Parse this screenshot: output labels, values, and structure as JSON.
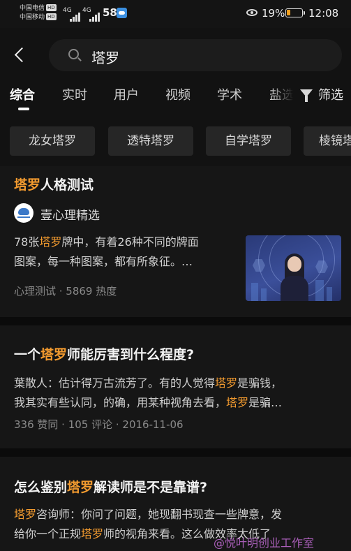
{
  "status_bar": {
    "carrier1": "中国电信",
    "carrier2": "中国移动",
    "hd_badge": "HD",
    "signal1_type": "4G",
    "signal2_type": "4G",
    "network": "58",
    "battery_percent": "19%",
    "battery_level": 0.19,
    "time": "12:08"
  },
  "search": {
    "query": "塔罗",
    "icon": "search-icon"
  },
  "tabs": [
    {
      "label": "综合",
      "active": true
    },
    {
      "label": "实时",
      "active": false
    },
    {
      "label": "用户",
      "active": false
    },
    {
      "label": "视频",
      "active": false
    },
    {
      "label": "学术",
      "active": false
    },
    {
      "label": "盐选",
      "active": false
    }
  ],
  "filter_label": "筛选",
  "chips": [
    "龙女塔罗",
    "透特塔罗",
    "自学塔罗",
    "棱镜塔罗"
  ],
  "results": [
    {
      "title_hl": "塔罗",
      "title_rest": "人格测试",
      "source_name": "壹心理精选",
      "source_logo_text": "壹心理",
      "line1_pre": "78张",
      "line1_hl": "塔罗",
      "line1_post": "牌中，有着26种不同的牌面",
      "line2": "图案，每一种图案，都有所象征。…",
      "meta": "心理测试 · 5869 热度"
    },
    {
      "title_pre": "一个",
      "title_hl": "塔罗",
      "title_post": "师能厉害到什么程度?",
      "line1_pre": "葉散人：估计得万古流芳了。有的人觉得",
      "line1_hl": "塔罗",
      "line1_post": "是骗钱，",
      "line2_pre": "我其实有些认同，的确，用某种视角去看，",
      "line2_hl": "塔罗",
      "line2_post": "是骗…",
      "meta": "336 赞同 · 105 评论 · 2016-11-06"
    },
    {
      "title_pre": "怎么鉴别",
      "title_hl": "塔罗",
      "title_post": "解读师是不是靠谱?",
      "line1_hl": "塔罗",
      "line1_post": "咨询师：你问了问题，她现翻书现查一些牌意，发",
      "line2_pre": "给你一个正规",
      "line2_hl": "塔罗",
      "line2_post": "师的视角来看。这么做效率太低了"
    }
  ],
  "watermark": "@悦叶明创业工作室",
  "colors": {
    "background": "#121212",
    "card": "#161616",
    "highlight": "#f39b2f",
    "chip": "#262626",
    "muted": "#8a8a8a"
  }
}
